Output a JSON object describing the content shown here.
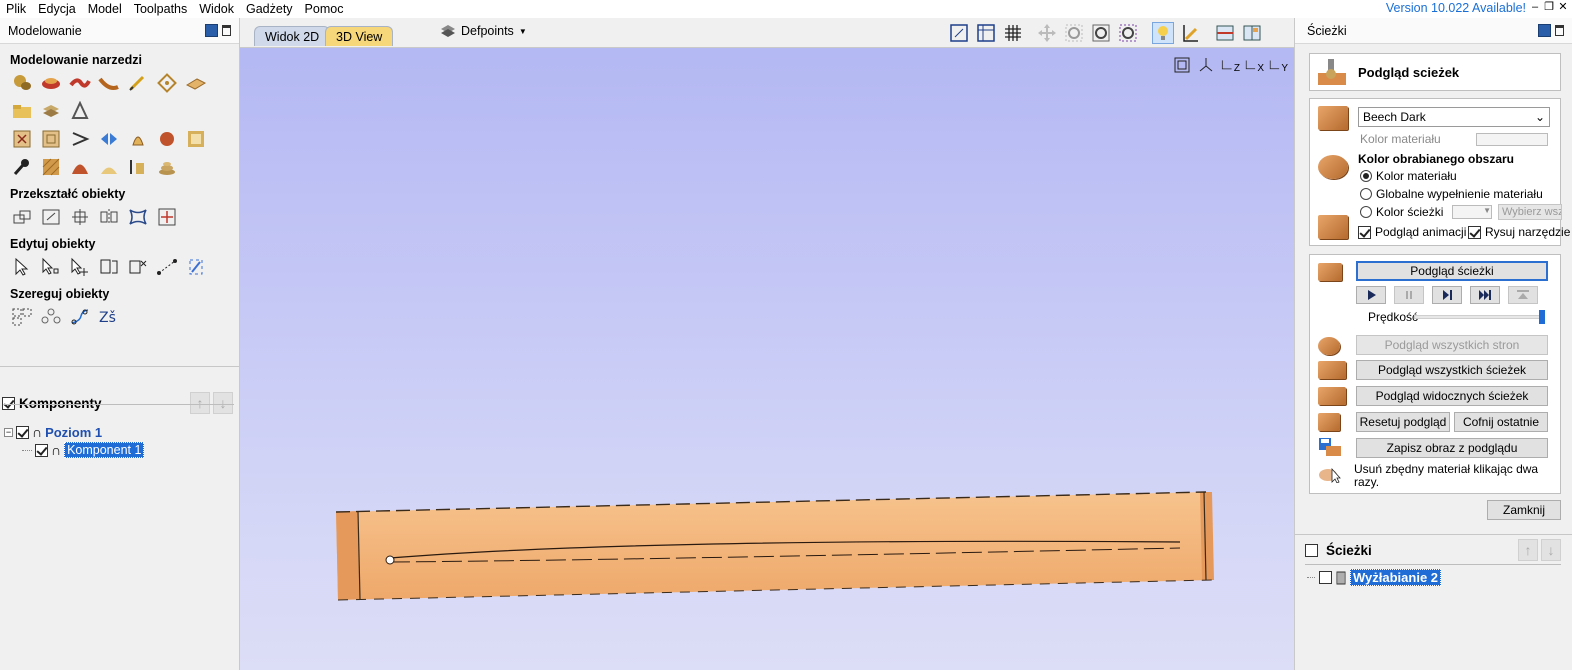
{
  "menubar": {
    "items": [
      "Plik",
      "Edycja",
      "Model",
      "Toolpaths",
      "Widok",
      "Gadżety",
      "Pomoc"
    ],
    "version": "Version 10.022 Available!"
  },
  "left_panel": {
    "title": "Modelowanie",
    "sections": {
      "modeling": "Modelowanie narzedzi",
      "transform": "Przekształć obiekty",
      "edit": "Edytuj obiekty",
      "arrange": "Szereguj obiekty"
    },
    "components": {
      "title": "Komponenty",
      "level": "Poziom 1",
      "item": "Komponent 1"
    }
  },
  "center": {
    "tabs": [
      "Widok 2D",
      "3D View"
    ],
    "layer_dropdown": "Defpoints",
    "axis_labels": [
      "Z",
      "X",
      "Y"
    ]
  },
  "right_panel": {
    "title": "Ścieżki",
    "preview_title": "Podgląd scieżek",
    "material": {
      "selected": "Beech Dark",
      "color_label": "Kolor materiału"
    },
    "machined_area": {
      "title": "Kolor obrabianego obszaru",
      "options": [
        "Kolor materiału",
        "Globalne wypełnienie materiału",
        "Kolor ścieżki"
      ],
      "select_all": "Wybierz wszy"
    },
    "checkboxes": {
      "animation": "Podgląd animacji",
      "draw_tool": "Rysuj narzędzie"
    },
    "buttons": {
      "preview_path": "Podgląd ścieżki",
      "speed": "Prędkość",
      "preview_all_sides": "Podgląd wszystkich stron",
      "preview_all_paths": "Podgląd wszystkich ścieżek",
      "preview_visible_paths": "Podgląd widocznych ścieżek",
      "reset_preview": "Resetuj podgląd",
      "undo_last": "Cofnij ostatnie",
      "save_image": "Zapisz obraz z podglądu",
      "remove_material_hint": "Usuń zbędny materiał klikając dwa razy.",
      "close": "Zamknij"
    },
    "toolpaths": {
      "title": "Ścieżki",
      "item": "Wyżłabianie 2"
    }
  },
  "colors": {
    "accent": "#1f6cd6",
    "tab_active": "#f6d77a",
    "viewport_top": "#b4b8f3",
    "wood": "#f4b27a"
  }
}
